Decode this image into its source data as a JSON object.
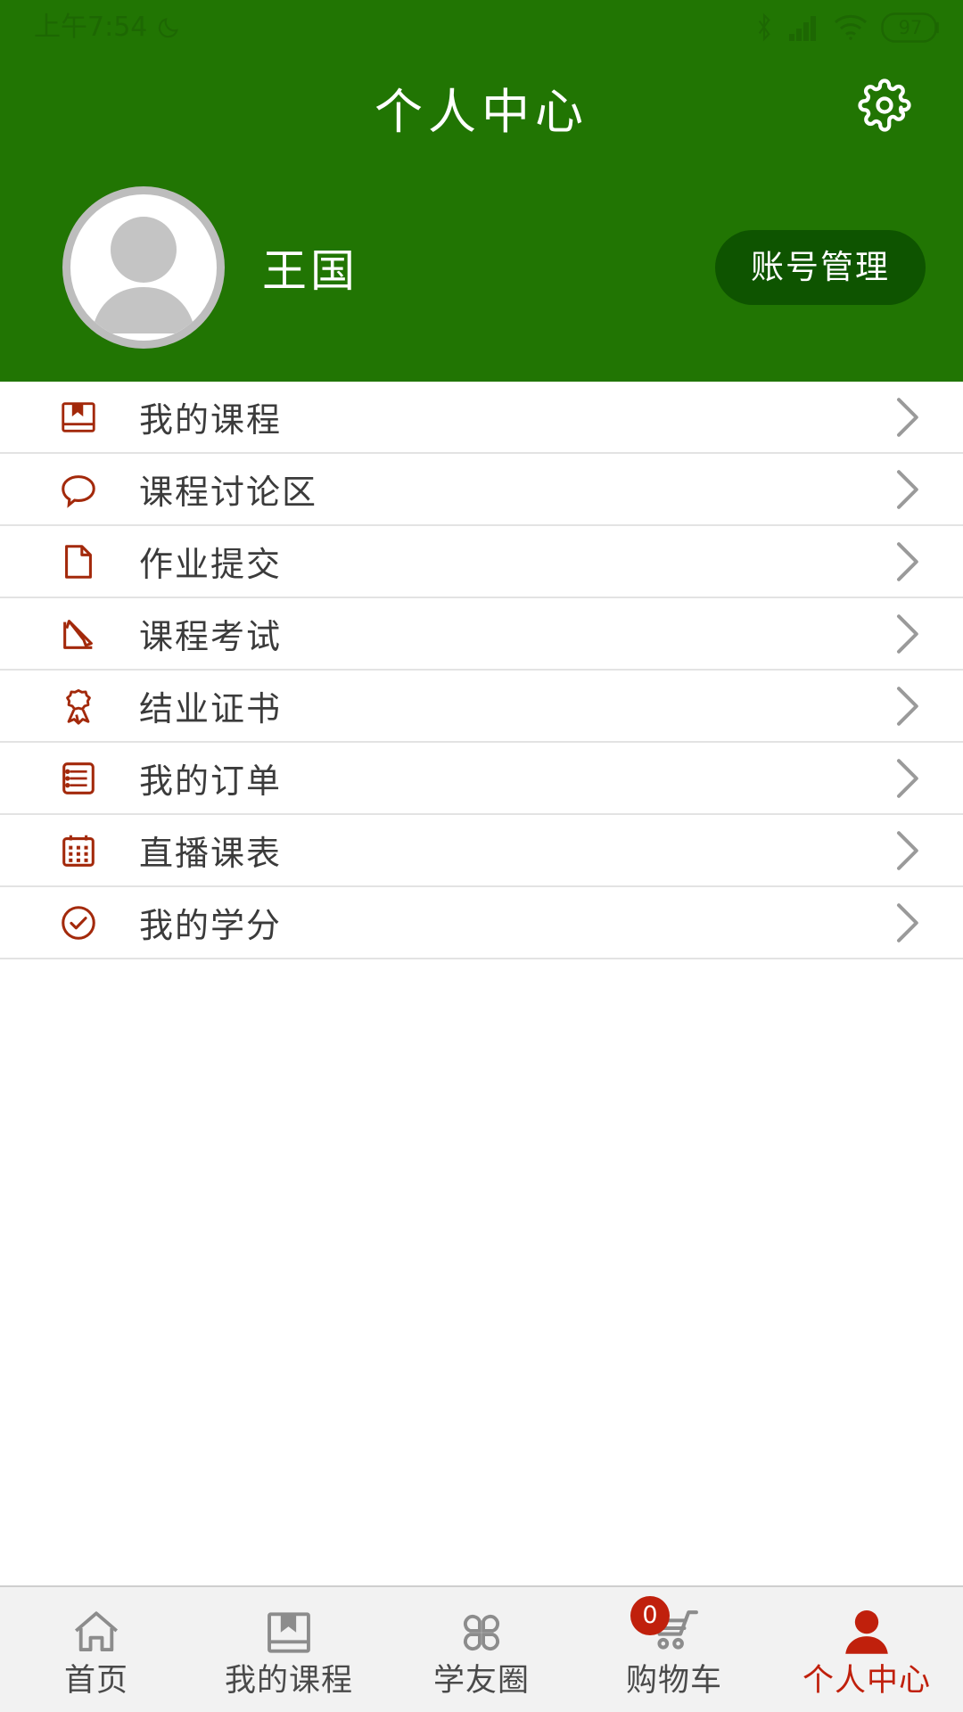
{
  "status_bar": {
    "time": "上午7:54",
    "moon_icon": "moon-icon",
    "bluetooth_icon": "bluetooth-icon",
    "signal_icon": "signal-icon",
    "wifi_icon": "wifi-icon",
    "battery_level": "97"
  },
  "header": {
    "title": "个人中心",
    "settings_icon": "gear-icon",
    "background_color": "#217503"
  },
  "profile": {
    "avatar_icon": "default-user-avatar",
    "username": "王国",
    "account_button_label": "账号管理",
    "account_button_color": "#0e5400"
  },
  "menu": {
    "accent_color": "#a3290b",
    "items": [
      {
        "label": "我的课程",
        "icon": "book-icon",
        "chevron": "chevron-right-icon"
      },
      {
        "label": "课程讨论区",
        "icon": "chat-bubble-icon",
        "chevron": "chevron-right-icon"
      },
      {
        "label": "作业提交",
        "icon": "document-icon",
        "chevron": "chevron-right-icon"
      },
      {
        "label": "课程考试",
        "icon": "pencil-icon",
        "chevron": "chevron-right-icon"
      },
      {
        "label": "结业证书",
        "icon": "award-ribbon-icon",
        "chevron": "chevron-right-icon"
      },
      {
        "label": "我的订单",
        "icon": "list-icon",
        "chevron": "chevron-right-icon"
      },
      {
        "label": "直播课表",
        "icon": "calendar-icon",
        "chevron": "chevron-right-icon"
      },
      {
        "label": "我的学分",
        "icon": "check-circle-icon",
        "chevron": "chevron-right-icon"
      }
    ]
  },
  "tabbar": {
    "active_color": "#c0200c",
    "inactive_color": "#4a4a4a",
    "items": [
      {
        "label": "首页",
        "icon": "home-icon",
        "active": false,
        "badge": null
      },
      {
        "label": "我的课程",
        "icon": "book-icon",
        "active": false,
        "badge": null
      },
      {
        "label": "学友圈",
        "icon": "clover-group-icon",
        "active": false,
        "badge": null
      },
      {
        "label": "购物车",
        "icon": "shopping-cart-icon",
        "active": false,
        "badge": "0"
      },
      {
        "label": "个人中心",
        "icon": "person-icon",
        "active": true,
        "badge": null
      }
    ]
  }
}
